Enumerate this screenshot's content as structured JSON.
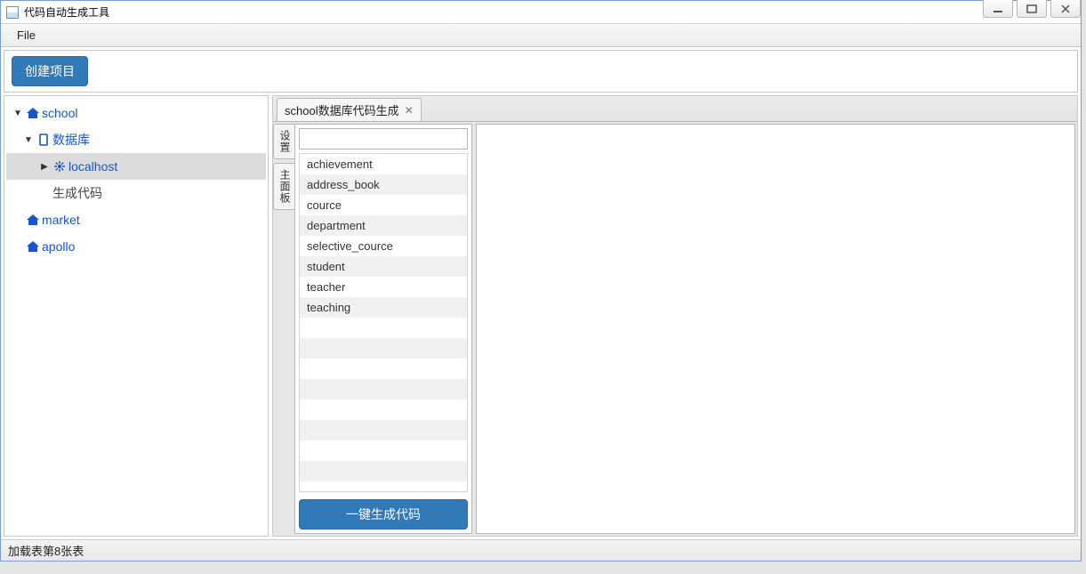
{
  "window": {
    "title": "代码自动生成工具"
  },
  "menu": {
    "file": "File"
  },
  "toolbar": {
    "create_project": "创建项目"
  },
  "tree": {
    "items": [
      {
        "label": "school",
        "type": "home",
        "level": 0,
        "expander": "▼",
        "blue": true
      },
      {
        "label": "数据库",
        "type": "db",
        "level": 1,
        "expander": "▼",
        "blue": true
      },
      {
        "label": "localhost",
        "type": "conn",
        "level": 2,
        "expander": "▶",
        "blue": true,
        "selected": true
      },
      {
        "label": "生成代码",
        "type": "none",
        "level": 1,
        "expander": "",
        "blue": false
      },
      {
        "label": "market",
        "type": "home",
        "level": 0,
        "expander": "",
        "blue": true
      },
      {
        "label": "apollo",
        "type": "home",
        "level": 0,
        "expander": "",
        "blue": true
      }
    ]
  },
  "tab": {
    "label": "school数据库代码生成"
  },
  "vtabs": {
    "settings": "设置",
    "main_panel": "主面板"
  },
  "tables": [
    "achievement",
    "address_book",
    "cource",
    "department",
    "selective_cource",
    "student",
    "teacher",
    "teaching"
  ],
  "buttons": {
    "generate": "一键生成代码"
  },
  "status": {
    "text": "加载表第8张表"
  }
}
